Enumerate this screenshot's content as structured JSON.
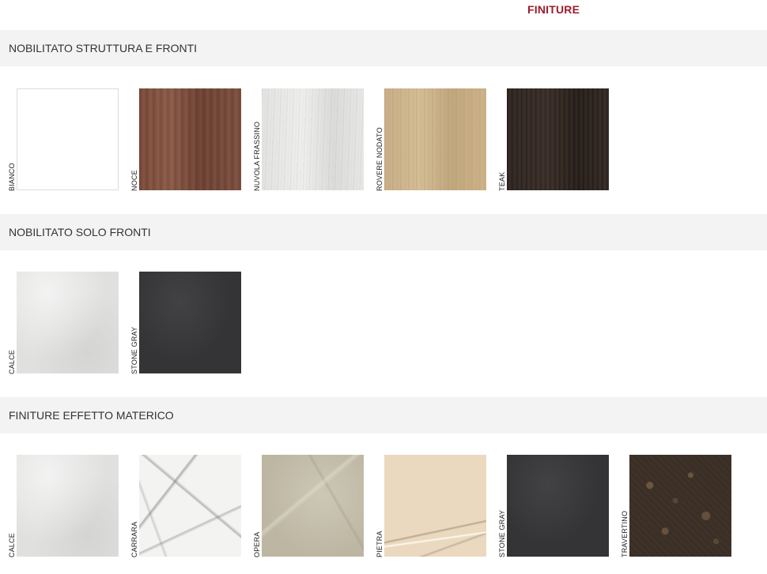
{
  "page_title": "FINITURE",
  "colors": {
    "accent": "#9d1c2b",
    "header_bg": "#f3f3f3",
    "text": "#333333"
  },
  "sections": [
    {
      "title": "NOBILITATO STRUTTURA E FRONTI",
      "swatches": [
        {
          "label": "BIANCO",
          "texture": "bianco"
        },
        {
          "label": "NOCE",
          "texture": "noce"
        },
        {
          "label": "NUVOLA FRASSINO",
          "texture": "nuvola"
        },
        {
          "label": "ROVERE NODATO",
          "texture": "rovere"
        },
        {
          "label": "TEAK",
          "texture": "teak"
        }
      ]
    },
    {
      "title": "NOBILITATO SOLO FRONTI",
      "swatches": [
        {
          "label": "CALCE",
          "texture": "calce"
        },
        {
          "label": "STONE GRAY",
          "texture": "stone"
        }
      ]
    },
    {
      "title": "FINITURE EFFETTO MATERICO",
      "swatches": [
        {
          "label": "CALCE",
          "texture": "calce"
        },
        {
          "label": "CARRARA",
          "texture": "carrara"
        },
        {
          "label": "OPERA",
          "texture": "opera"
        },
        {
          "label": "PIETRA",
          "texture": "pietra"
        },
        {
          "label": "STONE GRAY",
          "texture": "stone"
        },
        {
          "label": "TRAVERTINO",
          "texture": "travertino"
        }
      ]
    }
  ]
}
